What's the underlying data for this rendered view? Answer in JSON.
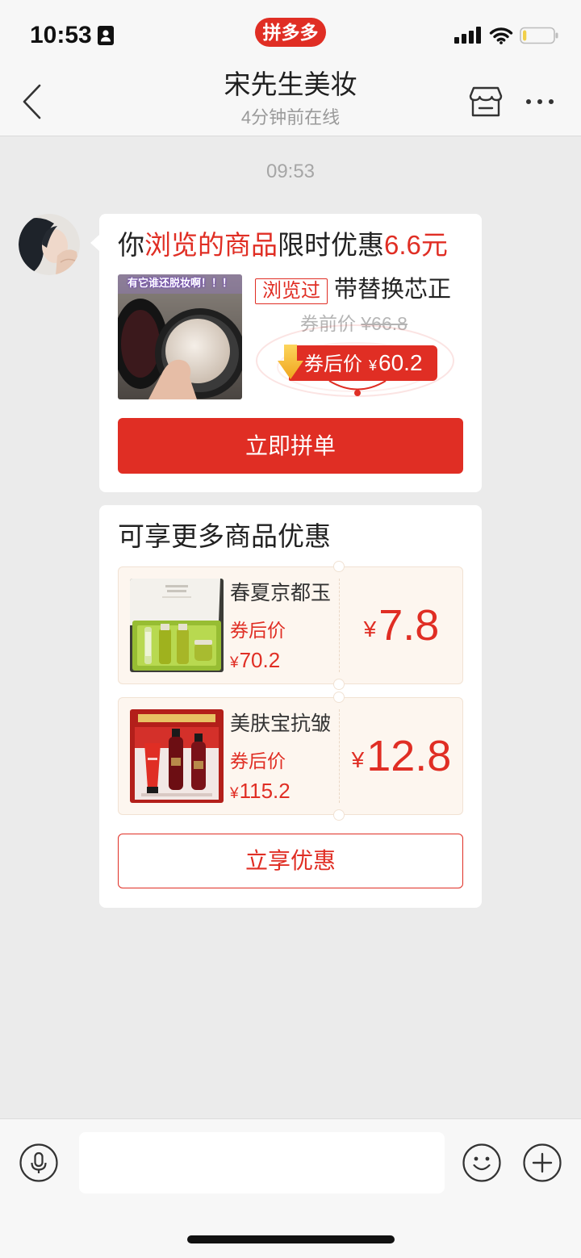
{
  "theme": {
    "accent": "#e02e24",
    "chat_bg": "#ebebeb",
    "bar_bg": "#f7f7f7",
    "coupon_bg": "#fdf6ef",
    "muted": "#9a9a9a"
  },
  "status_bar": {
    "time": "10:53",
    "app_badge": "拼多多",
    "battery_level": 0.12,
    "icons": [
      "contact-card-icon",
      "signal-icon",
      "wifi-icon",
      "battery-icon"
    ]
  },
  "header": {
    "title": "宋先生美妆",
    "subtitle": "4分钟前在线",
    "icons": [
      "chevron-left-icon",
      "store-icon",
      "more-icon"
    ]
  },
  "chat": {
    "timestamp": "09:53",
    "promo_card": {
      "title_prefix": "你",
      "title_highlight": "浏览的商品",
      "title_middle": "限时优惠",
      "title_amount": "6.6元",
      "product": {
        "image_caption": "有它谁还脱妆啊！！！",
        "tag": "浏览过",
        "name": "带替换芯正",
        "price_before_label": "券前价",
        "price_before": "¥66.8",
        "price_after_label": "券后价",
        "price_after_symbol": "¥",
        "price_after": "60.2"
      },
      "button": "立即拼单"
    },
    "more_card": {
      "title": "可享更多商品优惠",
      "items": [
        {
          "name": "春夏京都玉",
          "price_label": "券后价",
          "price_symbol": "¥",
          "price": "70.2",
          "coupon_symbol": "¥",
          "coupon_value": "7.8"
        },
        {
          "name": "美肤宝抗皱",
          "price_label": "券后价",
          "price_symbol": "¥",
          "price": "115.2",
          "coupon_symbol": "¥",
          "coupon_value": "12.8"
        }
      ],
      "button": "立享优惠"
    }
  },
  "composer": {
    "input_value": "",
    "icons": [
      "microphone-icon",
      "emoji-icon",
      "plus-icon"
    ]
  }
}
